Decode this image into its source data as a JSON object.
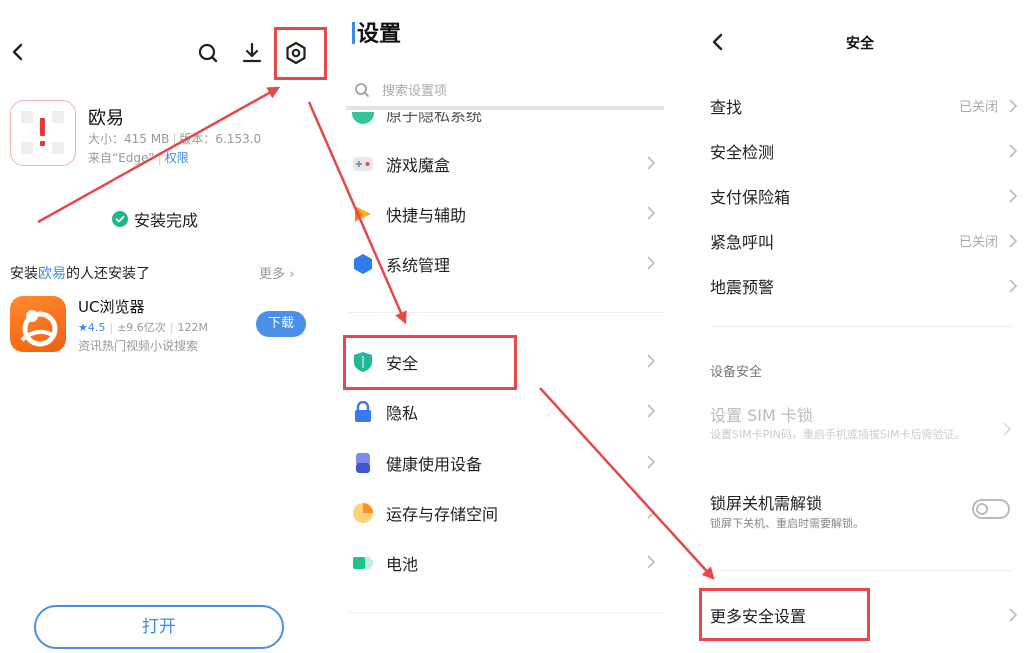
{
  "store": {
    "app": {
      "name": "欧易",
      "size": "大小：415 MB",
      "version": "版本：6.153.0",
      "source": "来自“Edge”",
      "permission": "权限"
    },
    "status": "安装完成",
    "recommend": {
      "prefix": "安装",
      "app_name": "欧易",
      "suffix": "的人还安装了",
      "more": "更多"
    },
    "suggestion": {
      "name": "UC浏览器",
      "rating": "4.5",
      "downloads": "±9.6亿次",
      "size": "122M",
      "desc": "资讯热门视频小说搜索",
      "button": "下载"
    },
    "open_button": "打开"
  },
  "settings": {
    "title": "设置",
    "search_placeholder": "搜索设置项",
    "cut_item": "原子隐私系统",
    "items": [
      {
        "label": "游戏魔盒",
        "icon": "game-box-icon"
      },
      {
        "label": "快捷与辅助",
        "icon": "shortcut-icon"
      },
      {
        "label": "系统管理",
        "icon": "system-management-icon"
      },
      {
        "label": "安全",
        "icon": "security-shield-icon"
      },
      {
        "label": "隐私",
        "icon": "privacy-lock-icon"
      },
      {
        "label": "健康使用设备",
        "icon": "health-usage-icon"
      },
      {
        "label": "运存与存储空间",
        "icon": "storage-pie-icon"
      },
      {
        "label": "电池",
        "icon": "battery-icon"
      }
    ]
  },
  "security": {
    "title": "安全",
    "items": [
      {
        "label": "查找",
        "value": "已关闭"
      },
      {
        "label": "安全检测",
        "value": ""
      },
      {
        "label": "支付保险箱",
        "value": ""
      },
      {
        "label": "紧急呼叫",
        "value": "已关闭"
      },
      {
        "label": "地震预警",
        "value": ""
      }
    ],
    "device_section": "设备安全",
    "sim_lock": {
      "title": "设置 SIM 卡锁",
      "desc": "设置SIM卡PIN码，重启手机或插拔SIM卡后需验证。"
    },
    "lockscreen": {
      "title": "锁屏关机需解锁",
      "desc": "锁屏下关机、重启时需要解锁。",
      "enabled": false
    },
    "more": "更多安全设置"
  },
  "colors": {
    "accent": "#3f8ae8",
    "annotation": "#e4484b",
    "success": "#1fb58a"
  }
}
